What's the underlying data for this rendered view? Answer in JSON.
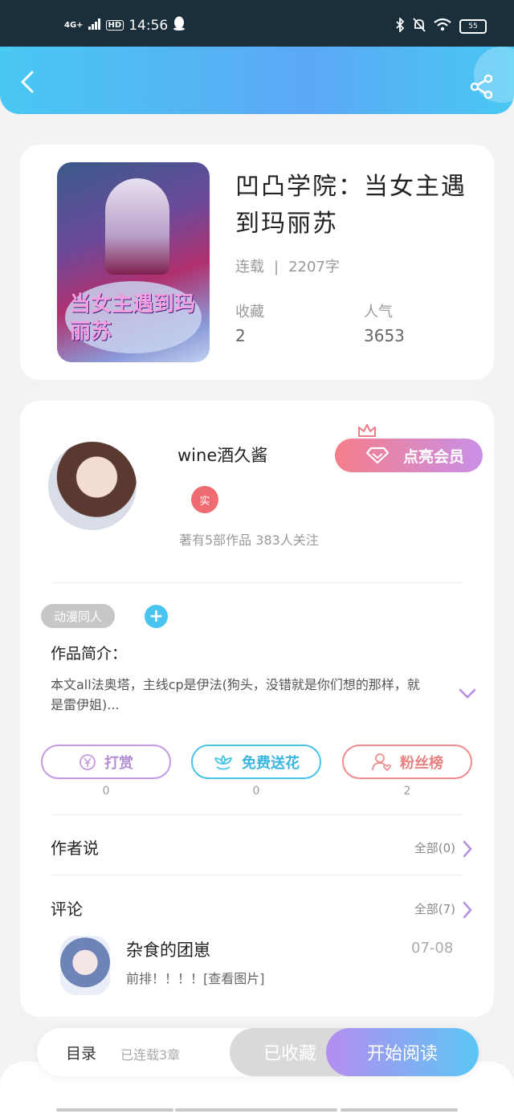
{
  "status_bar": {
    "network": "4G+",
    "hd": "HD",
    "time": "14:56",
    "battery": "55"
  },
  "book": {
    "cover_text": "当女主遇到玛丽苏",
    "title": "凹凸学院：当女主遇到玛丽苏",
    "status": "连载",
    "word_count": "2207字",
    "favorites_label": "收藏",
    "favorites_value": "2",
    "popularity_label": "人气",
    "popularity_value": "3653"
  },
  "author": {
    "name": "wine酒久酱",
    "verified_badge": "实",
    "stats": "著有5部作品 383人关注",
    "member_button": "点亮会员"
  },
  "tags": {
    "items": [
      "动漫同人"
    ],
    "add_label": "+"
  },
  "intro": {
    "title": "作品简介：",
    "text": "本文all法奥塔，主线cp是伊法(狗头，没错就是你们想的那样，就是雷伊姐)..."
  },
  "actions": {
    "reward_label": "打赏",
    "reward_count": "0",
    "flower_label": "免费送花",
    "flower_count": "0",
    "fans_label": "粉丝榜",
    "fans_count": "2"
  },
  "author_says": {
    "title": "作者说",
    "link": "全部(0)"
  },
  "comments": {
    "title": "评论",
    "link": "全部(7)",
    "items": [
      {
        "user": "杂食的团崽",
        "text": "前排！！！！[查看图片]",
        "date": "07-08"
      }
    ]
  },
  "bottom_bar": {
    "catalog": "目录",
    "chapters": "已连载3章",
    "collected": "已收藏",
    "start_reading": "开始阅读"
  },
  "colors": {
    "top_bar_gradient_start": "#49c8f3",
    "top_bar_gradient_end": "#5ba8f5",
    "accent_pink": "#f06b72",
    "accent_blue": "#49c4f0"
  }
}
